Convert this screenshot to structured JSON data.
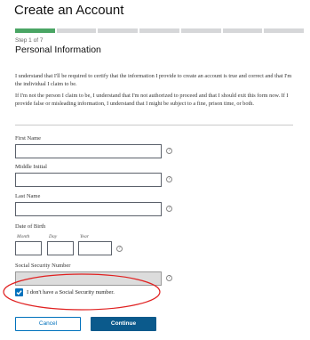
{
  "header": {
    "title": "Create an Account"
  },
  "progress": {
    "total_steps": 7,
    "current_step": 1,
    "step_text": "Step 1 of 7",
    "colors": {
      "done": "#4aa564",
      "pending": "#d6d7d9"
    }
  },
  "section": {
    "title": "Personal Information"
  },
  "paragraphs": [
    "I understand that I'll be required to certify that the information I provide to create an account is true and correct and that I'm the individual I claim to be.",
    "If I'm not the person I claim to be, I understand that I'm not authorized to proceed and that I should exit this form now. If I provide false or misleading information, I understand that I might be subject to a fine, prison time, or both."
  ],
  "fields": {
    "first_name": {
      "label": "First Name",
      "value": ""
    },
    "middle_initial": {
      "label": "Middle Initial",
      "value": ""
    },
    "last_name": {
      "label": "Last Name",
      "value": ""
    },
    "dob": {
      "label": "Date of Birth",
      "month_label": "Month",
      "day_label": "Day",
      "year_label": "Year",
      "month": "",
      "day": "",
      "year": ""
    },
    "ssn": {
      "label": "Social Security Number",
      "value": "",
      "disabled": true
    }
  },
  "no_ssn": {
    "label": "I don't have a Social Security number.",
    "checked": true
  },
  "help_icon": "question-circle",
  "buttons": {
    "cancel": "Cancel",
    "continue": "Continue"
  },
  "colors": {
    "primary": "#0071bc",
    "continue_bg": "#0b5a8c",
    "annotation": "#e02020"
  }
}
